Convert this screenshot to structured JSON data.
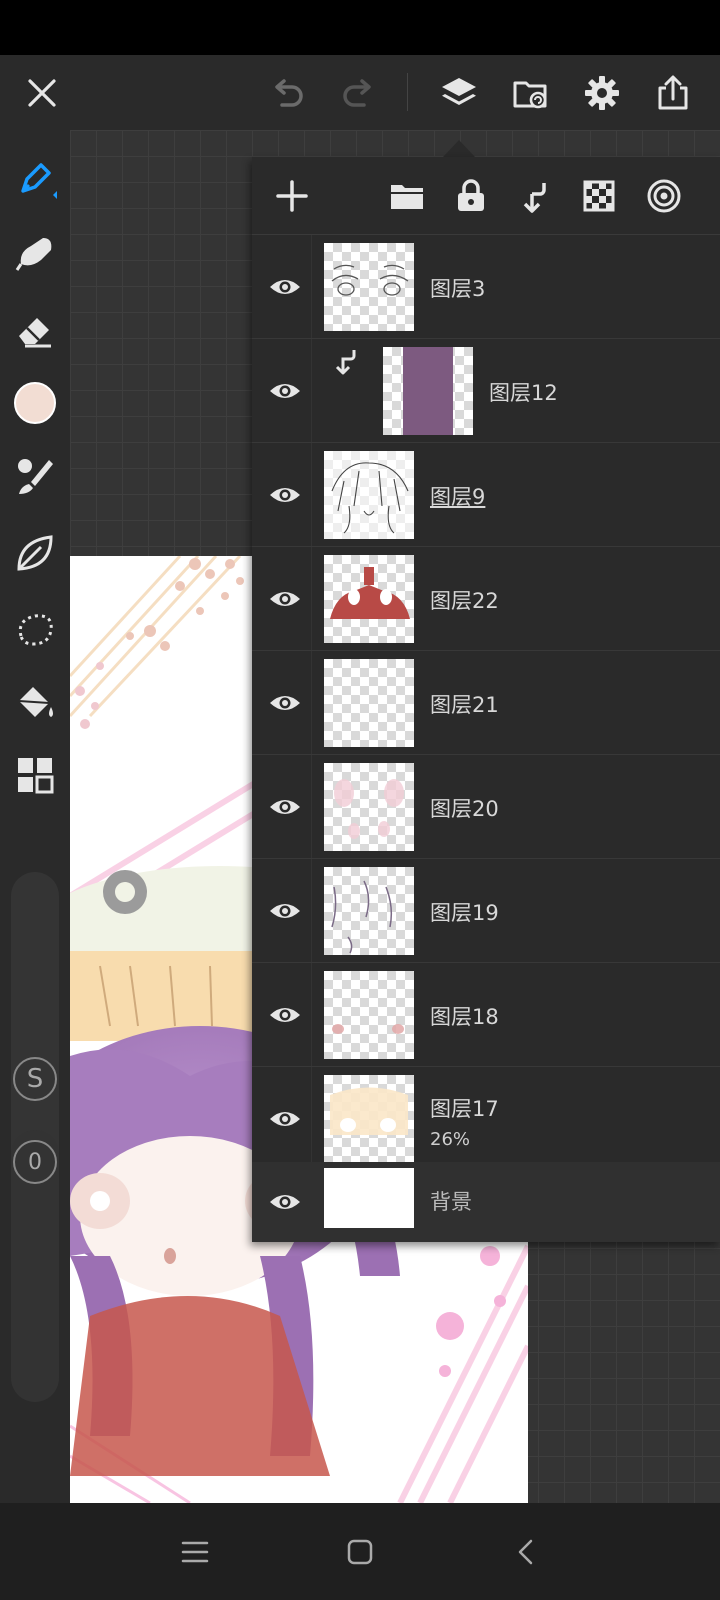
{
  "colors": {
    "accent": "#1a9bff",
    "panel_bg": "#2a2a2a",
    "icon": "#e6e6e6",
    "icon_disabled": "#6b6b6b",
    "current_color": "#f2ddd3"
  },
  "topbar": {
    "close": "close-icon",
    "undo": "undo-icon",
    "redo": "redo-icon",
    "layers": "layers-icon",
    "gallery": "gallery-icon",
    "settings": "gear-icon",
    "share": "share-icon"
  },
  "tools": [
    "pen-icon",
    "smudge-icon",
    "eraser-icon",
    "color-swatch",
    "brush-icon",
    "leaf-icon",
    "lasso-icon",
    "fill-icon",
    "grid-icon"
  ],
  "sliders": {
    "size_marker": "S",
    "opacity_marker": "0"
  },
  "layers_toolbar": [
    "add-icon",
    "folder-icon",
    "lock-icon",
    "clip-icon",
    "transparency-icon",
    "blend-icon"
  ],
  "layers": [
    {
      "name": "图层3",
      "opacity": ""
    },
    {
      "name": "图层12",
      "opacity": "",
      "clipped": true
    },
    {
      "name": "图层9",
      "opacity": "",
      "underlined": true
    },
    {
      "name": "图层22",
      "opacity": ""
    },
    {
      "name": "图层21",
      "opacity": ""
    },
    {
      "name": "图层20",
      "opacity": ""
    },
    {
      "name": "图层19",
      "opacity": ""
    },
    {
      "name": "图层18",
      "opacity": ""
    },
    {
      "name": "图层17",
      "opacity": "26%"
    },
    {
      "name": "背景",
      "opacity": ""
    }
  ],
  "navbar": [
    "menu-icon",
    "home-icon",
    "back-icon"
  ]
}
